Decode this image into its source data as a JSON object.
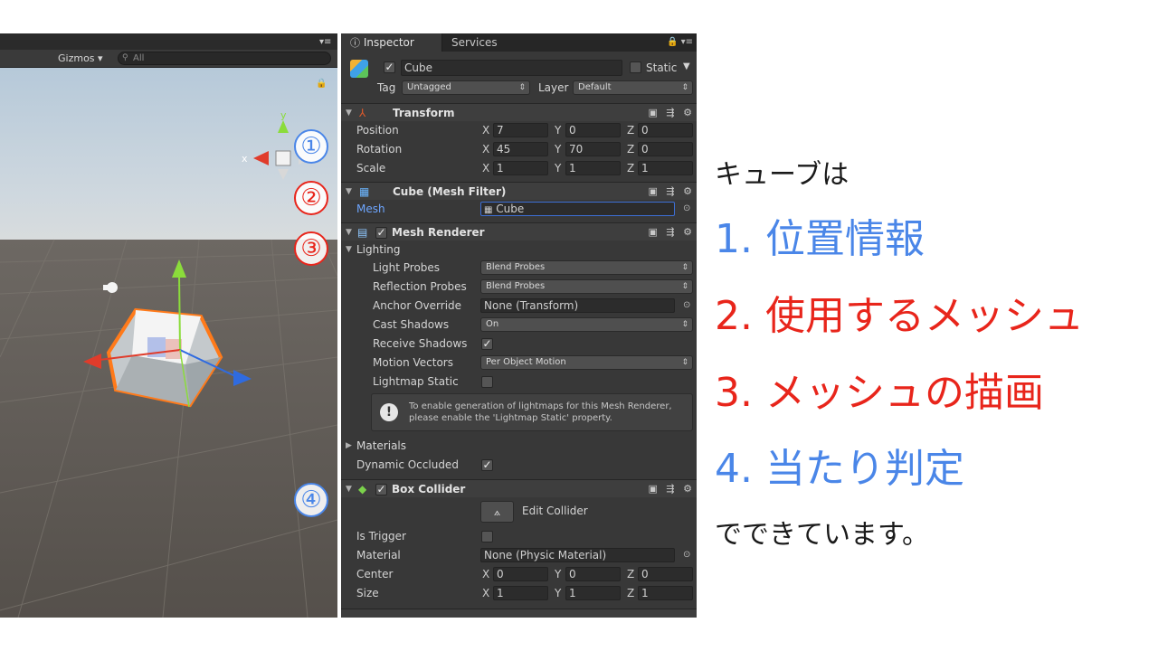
{
  "scene": {
    "gizmos_label": "Gizmos ▾",
    "search_placeholder": "All",
    "axis_x": "x",
    "axis_y": "y"
  },
  "inspector": {
    "tabs": [
      {
        "label": "Inspector"
      },
      {
        "label": "Services"
      }
    ],
    "object": {
      "name": "Cube",
      "static_label": "Static",
      "tag_label": "Tag",
      "tag_value": "Untagged",
      "layer_label": "Layer",
      "layer_value": "Default"
    },
    "transform": {
      "title": "Transform",
      "position_label": "Position",
      "rotation_label": "Rotation",
      "scale_label": "Scale",
      "position": {
        "x": "7",
        "y": "0",
        "z": "0"
      },
      "rotation": {
        "x": "45",
        "y": "70",
        "z": "0"
      },
      "scale": {
        "x": "1",
        "y": "1",
        "z": "1"
      }
    },
    "mesh_filter": {
      "title": "Cube (Mesh Filter)",
      "mesh_label": "Mesh",
      "mesh_value": "Cube"
    },
    "mesh_renderer": {
      "title": "Mesh Renderer",
      "lighting_label": "Lighting",
      "light_probes_label": "Light Probes",
      "light_probes_value": "Blend Probes",
      "reflection_probes_label": "Reflection Probes",
      "reflection_probes_value": "Blend Probes",
      "anchor_override_label": "Anchor Override",
      "anchor_override_value": "None (Transform)",
      "cast_shadows_label": "Cast Shadows",
      "cast_shadows_value": "On",
      "receive_shadows_label": "Receive Shadows",
      "motion_vectors_label": "Motion Vectors",
      "motion_vectors_value": "Per Object Motion",
      "lightmap_static_label": "Lightmap Static",
      "info_line1": "To enable generation of lightmaps for this Mesh Renderer,",
      "info_line2": "please enable the 'Lightmap Static' property.",
      "materials_label": "Materials",
      "dynamic_occluded_label": "Dynamic Occluded"
    },
    "box_collider": {
      "title": "Box Collider",
      "edit_collider_label": "Edit Collider",
      "is_trigger_label": "Is Trigger",
      "material_label": "Material",
      "material_value": "None (Physic Material)",
      "center_label": "Center",
      "size_label": "Size",
      "center": {
        "x": "0",
        "y": "0",
        "z": "0"
      },
      "size": {
        "x": "1",
        "y": "1",
        "z": "1"
      }
    }
  },
  "annotations": {
    "markers": [
      "①",
      "②",
      "③",
      "④"
    ],
    "intro": "キューブは",
    "items": [
      {
        "text": "1. 位置情報",
        "color": "#4a86e8"
      },
      {
        "text": "2. 使用するメッシュ",
        "color": "#e8251b"
      },
      {
        "text": "3. メッシュの描画",
        "color": "#e8251b"
      },
      {
        "text": "4. 当たり判定",
        "color": "#4a86e8"
      }
    ],
    "outro": "でできています。"
  },
  "colors": {
    "blue": "#4a86e8",
    "red": "#e8251b",
    "inspector_bg": "#383838",
    "scene_ground": "#5b5754"
  }
}
